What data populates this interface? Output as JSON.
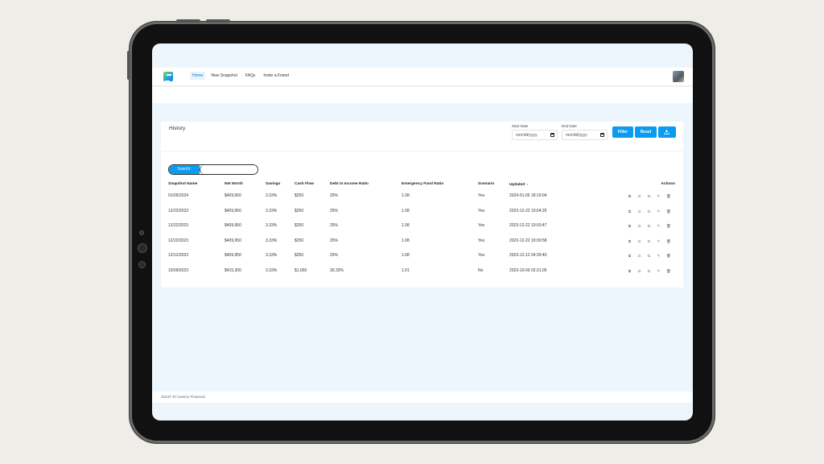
{
  "nav": {
    "links": [
      "Home",
      "New Snapshot",
      "FAQs",
      "Invite a Friend"
    ]
  },
  "history": {
    "title": "History",
    "start_date": {
      "label": "Start Date",
      "placeholder": "mm/dd/yyyy"
    },
    "end_date": {
      "label": "End Date",
      "placeholder": "mm/dd/yyyy"
    },
    "filter_label": "Filter",
    "reset_label": "Reset",
    "search_label": "Search:",
    "columns": [
      "Snapshot Name",
      "Net Worth",
      "Savings",
      "Cash Flow",
      "Debt to Income Ratio",
      "Emergency Fund Ratio",
      "Scenario",
      "Updated",
      "Actions"
    ],
    "rows": [
      [
        "01/05/2024",
        "$409,950",
        "3.33%",
        "$250",
        "25%",
        "1.08",
        "Yes",
        "2024-01-05 18:19:04"
      ],
      [
        "12/22/2023",
        "$409,950",
        "3.33%",
        "$250",
        "25%",
        "1.08",
        "Yes",
        "2023-12-22 19:04:25"
      ],
      [
        "12/22/2023",
        "$409,950",
        "3.33%",
        "$250",
        "25%",
        "1.08",
        "Yes",
        "2023-12-22 19:03:47"
      ],
      [
        "12/22/2023",
        "$409,950",
        "3.33%",
        "$250",
        "25%",
        "1.08",
        "Yes",
        "2023-12-22 19:00:58"
      ],
      [
        "12/12/2023",
        "$409,950",
        "3.33%",
        "$250",
        "25%",
        "1.08",
        "Yes",
        "2023-12-12 04:39:40"
      ],
      [
        "10/09/2023",
        "$415,300",
        "3.33%",
        "$1,650",
        "30.33%",
        "1.01",
        "No",
        "2023-10-09 02:31:05"
      ]
    ],
    "row_action_icons": [
      "copy-icon",
      "scale-icon",
      "compare-icon",
      "edit-icon",
      "trash-icon"
    ]
  },
  "footer": {
    "text": "2024© El Camino Financial"
  },
  "colors": {
    "accent": "#0a9cf0",
    "page_bg": "#eef6fd",
    "frame": "#111111"
  }
}
